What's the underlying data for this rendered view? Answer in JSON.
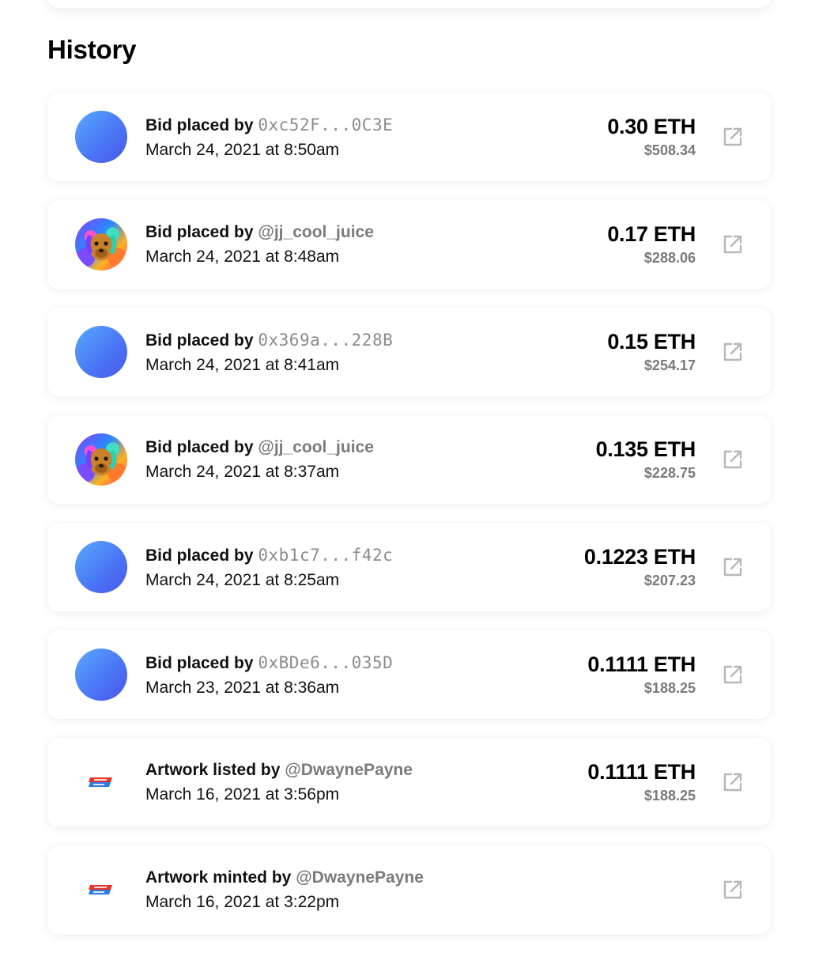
{
  "section": {
    "title": "History"
  },
  "history": [
    {
      "avatar": "gradient",
      "action": "Bid placed by",
      "actor": "0xc52F...0C3E",
      "actor_type": "address",
      "date": "March 24, 2021 at 8:50am",
      "eth": "0.30 ETH",
      "usd": "$508.34"
    },
    {
      "avatar": "dog",
      "action": "Bid placed by",
      "actor": "@jj_cool_juice",
      "actor_type": "handle",
      "date": "March 24, 2021 at 8:48am",
      "eth": "0.17 ETH",
      "usd": "$288.06"
    },
    {
      "avatar": "gradient",
      "action": "Bid placed by",
      "actor": "0x369a...228B",
      "actor_type": "address",
      "date": "March 24, 2021 at 8:41am",
      "eth": "0.15 ETH",
      "usd": "$254.17"
    },
    {
      "avatar": "dog",
      "action": "Bid placed by",
      "actor": "@jj_cool_juice",
      "actor_type": "handle",
      "date": "March 24, 2021 at 8:37am",
      "eth": "0.135 ETH",
      "usd": "$228.75"
    },
    {
      "avatar": "gradient",
      "action": "Bid placed by",
      "actor": "0xb1c7...f42c",
      "actor_type": "address",
      "date": "March 24, 2021 at 8:25am",
      "eth": "0.1223 ETH",
      "usd": "$207.23"
    },
    {
      "avatar": "gradient",
      "action": "Bid placed by",
      "actor": "0xBDe6...035D",
      "actor_type": "address",
      "date": "March 23, 2021 at 8:36am",
      "eth": "0.1111 ETH",
      "usd": "$188.25"
    },
    {
      "avatar": "logo",
      "action": "Artwork listed by",
      "actor": "@DwaynePayne",
      "actor_type": "handle",
      "date": "March 16, 2021 at 3:56pm",
      "eth": "0.1111 ETH",
      "usd": "$188.25"
    },
    {
      "avatar": "logo",
      "action": "Artwork minted by",
      "actor": "@DwaynePayne",
      "actor_type": "handle",
      "date": "March 16, 2021 at 3:22pm",
      "eth": "",
      "usd": ""
    }
  ],
  "icons": {
    "external_link": "external-link-icon"
  },
  "colors": {
    "avatar_gradient_start": "#5aa8ff",
    "avatar_gradient_end": "#4a55e8",
    "address_text": "#8b8b8b",
    "handle_text": "#7b7b7b",
    "usd_text": "#7a7a7a",
    "icon": "#b8b8b8"
  }
}
